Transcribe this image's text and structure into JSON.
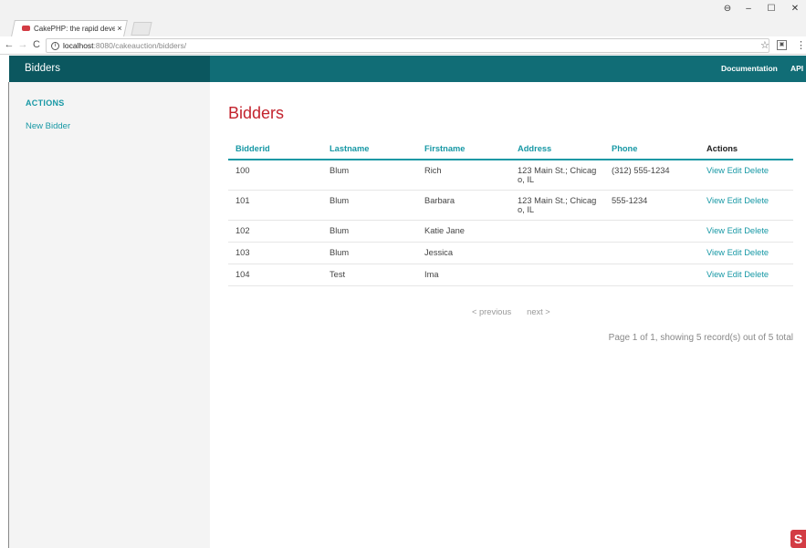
{
  "browser": {
    "tab_title": "CakePHP: the rapid deve",
    "tab_close": "×",
    "url_host": "localhost",
    "url_path": ":8080/cakeauction/bidders/",
    "info_glyph": "i",
    "back": "←",
    "forward": "→",
    "reload": "C",
    "star": "☆",
    "ext": "▣",
    "menu": "⋮",
    "account": "⊖",
    "minimize": "–",
    "maximize": "☐",
    "close": "✕"
  },
  "topbar": {
    "brand": "Bidders",
    "links": [
      "Documentation",
      "API"
    ]
  },
  "sidebar": {
    "heading": "ACTIONS",
    "items": [
      "New Bidder"
    ]
  },
  "main": {
    "title": "Bidders",
    "columns": [
      "Bidderid",
      "Lastname",
      "Firstname",
      "Address",
      "Phone",
      "Actions"
    ],
    "rows": [
      {
        "id": "100",
        "lastname": "Blum",
        "firstname": "Rich",
        "address": "123 Main St.; Chicag o, IL",
        "phone": "(312) 555-1234"
      },
      {
        "id": "101",
        "lastname": "Blum",
        "firstname": "Barbara",
        "address": "123 Main St.; Chicag o, IL",
        "phone": "555-1234"
      },
      {
        "id": "102",
        "lastname": "Blum",
        "firstname": "Katie Jane",
        "address": "",
        "phone": ""
      },
      {
        "id": "103",
        "lastname": "Blum",
        "firstname": "Jessica",
        "address": "",
        "phone": ""
      },
      {
        "id": "104",
        "lastname": "Test",
        "firstname": "Ima",
        "address": "",
        "phone": ""
      }
    ],
    "row_actions": [
      "View",
      "Edit",
      "Delete"
    ],
    "pager": {
      "previous": "< previous",
      "next": "next >"
    },
    "counter": "Page 1 of 1, showing 5 record(s) out of 5 total"
  },
  "colors": {
    "accent": "#1798a5",
    "topbar": "#116d76",
    "brand_bg": "#0b575f",
    "title_red": "#c3232d"
  }
}
